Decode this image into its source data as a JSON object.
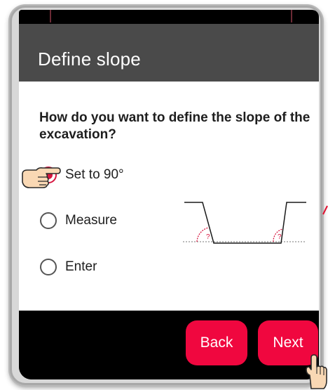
{
  "dialog": {
    "title": "Define slope",
    "question": "How do you want to define the slope of the excavation?"
  },
  "options": [
    {
      "label": "Set to 90°",
      "selected": true
    },
    {
      "label": "Measure",
      "selected": false
    },
    {
      "label": "Enter",
      "selected": false
    }
  ],
  "diagram": {
    "angle_marker": "?"
  },
  "buttons": {
    "back": "Back",
    "next": "Next"
  },
  "colors": {
    "accent": "#f0073f",
    "header": "#4a4a4a",
    "footer": "#000000",
    "diagram_marker": "#d6163f"
  }
}
